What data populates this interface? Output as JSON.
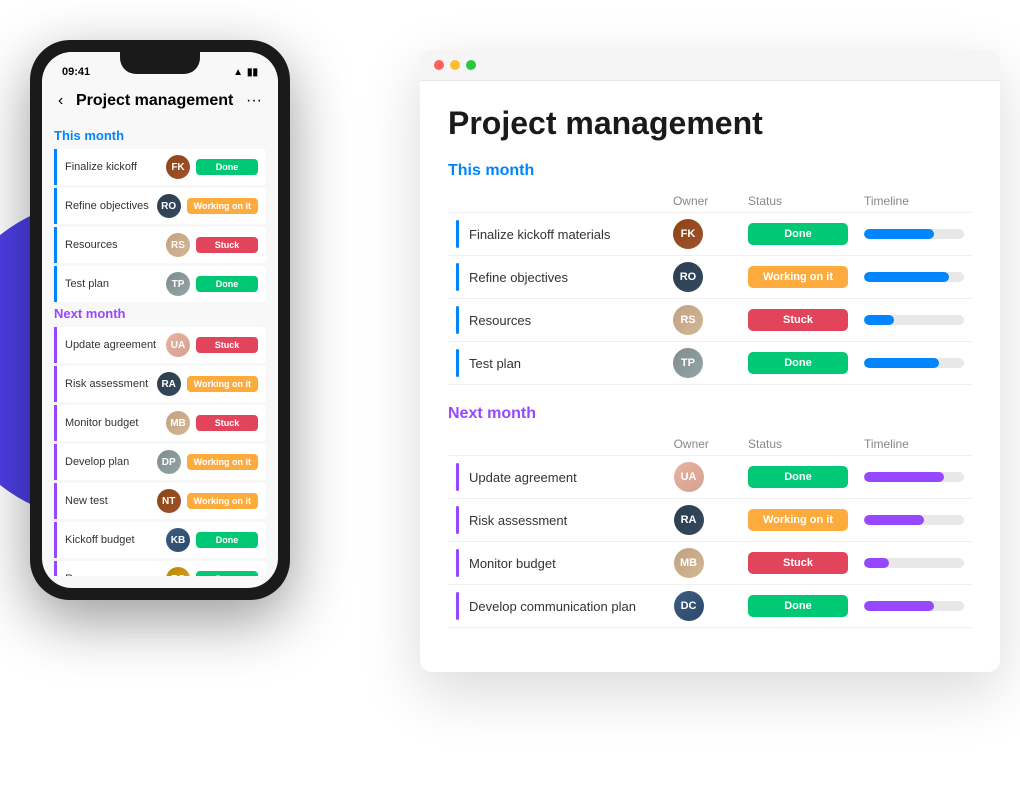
{
  "background": {
    "blob_color": "#4e3ee6"
  },
  "phone": {
    "status_time": "09:41",
    "header_back": "‹",
    "header_title": "Project management",
    "header_dots": "···",
    "this_month_label": "This month",
    "next_month_label": "Next month",
    "this_month_rows": [
      {
        "name": "Finalize kickoff",
        "status": "Done",
        "badge_class": "badge-done",
        "av": "av1"
      },
      {
        "name": "Refine objectives",
        "status": "Working on it",
        "badge_class": "badge-working",
        "av": "av2"
      },
      {
        "name": "Resources",
        "status": "Stuck",
        "badge_class": "badge-stuck",
        "av": "av3"
      },
      {
        "name": "Test plan",
        "status": "Done",
        "badge_class": "badge-done",
        "av": "av4"
      }
    ],
    "next_month_rows": [
      {
        "name": "Update agreement",
        "status": "Stuck",
        "badge_class": "badge-stuck",
        "av": "av5"
      },
      {
        "name": "Risk assessment",
        "status": "Working on it",
        "badge_class": "badge-working",
        "av": "av2"
      },
      {
        "name": "Monitor budget",
        "status": "Stuck",
        "badge_class": "badge-stuck",
        "av": "av3"
      },
      {
        "name": "Develop plan",
        "status": "Working on it",
        "badge_class": "badge-working",
        "av": "av4"
      },
      {
        "name": "New test",
        "status": "Working on it",
        "badge_class": "badge-working",
        "av": "av1"
      },
      {
        "name": "Kickoff budget",
        "status": "Done",
        "badge_class": "badge-done",
        "av": "av6"
      },
      {
        "name": "Resources",
        "status": "Done",
        "badge_class": "badge-done",
        "av": "av7"
      }
    ]
  },
  "desktop": {
    "title": "Project management",
    "titlebar_dots": [
      "●",
      "●",
      "●"
    ],
    "this_month_label": "This month",
    "next_month_label": "Next month",
    "col_owner": "Owner",
    "col_status": "Status",
    "col_timeline": "Timeline",
    "this_month_rows": [
      {
        "name": "Finalize kickoff materials",
        "status": "Done",
        "badge_class": "badge-done",
        "av": "av1",
        "timeline_width": 70,
        "timeline_class": "timeline-blue"
      },
      {
        "name": "Refine objectives",
        "status": "Working on it",
        "badge_class": "badge-working",
        "av": "av2",
        "timeline_width": 85,
        "timeline_class": "timeline-blue"
      },
      {
        "name": "Resources",
        "status": "Stuck",
        "badge_class": "badge-stuck",
        "av": "av3",
        "timeline_width": 30,
        "timeline_class": "timeline-blue"
      },
      {
        "name": "Test plan",
        "status": "Done",
        "badge_class": "badge-done",
        "av": "av4",
        "timeline_width": 75,
        "timeline_class": "timeline-blue"
      }
    ],
    "next_month_rows": [
      {
        "name": "Update agreement",
        "status": "Done",
        "badge_class": "badge-done",
        "av": "av5",
        "timeline_width": 80,
        "timeline_class": "timeline-purple"
      },
      {
        "name": "Risk assessment",
        "status": "Working on it",
        "badge_class": "badge-working",
        "av": "av2",
        "timeline_width": 60,
        "timeline_class": "timeline-purple"
      },
      {
        "name": "Monitor budget",
        "status": "Stuck",
        "badge_class": "badge-stuck",
        "av": "av3",
        "timeline_width": 25,
        "timeline_class": "timeline-purple"
      },
      {
        "name": "Develop communication plan",
        "status": "Done",
        "badge_class": "badge-done",
        "av": "av6",
        "timeline_width": 70,
        "timeline_class": "timeline-purple"
      }
    ]
  }
}
